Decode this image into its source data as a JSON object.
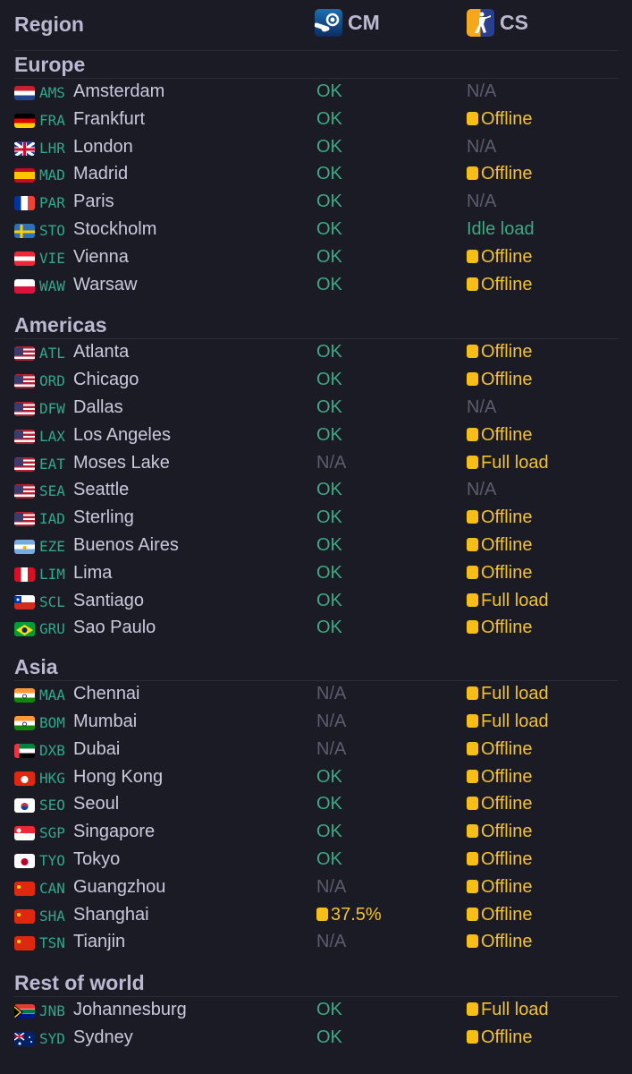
{
  "header": {
    "region_label": "Region",
    "cm_label": "CM",
    "cs_label": "CS",
    "cm_icon": "steam-icon",
    "cs_icon": "counter-strike-icon"
  },
  "colors": {
    "ok": "#3fa882",
    "na": "#5b5c6e",
    "warn": "#f2c230",
    "code": "#2fa98a",
    "bg": "#1b1b25"
  },
  "sections": [
    {
      "title": "Europe",
      "rows": [
        {
          "flag": "nl",
          "code": "AMS",
          "city": "Amsterdam",
          "cm": "OK",
          "cs": "N/A"
        },
        {
          "flag": "de",
          "code": "FRA",
          "city": "Frankfurt",
          "cm": "OK",
          "cs": "Offline"
        },
        {
          "flag": "gb",
          "code": "LHR",
          "city": "London",
          "cm": "OK",
          "cs": "N/A"
        },
        {
          "flag": "es",
          "code": "MAD",
          "city": "Madrid",
          "cm": "OK",
          "cs": "Offline"
        },
        {
          "flag": "fr",
          "code": "PAR",
          "city": "Paris",
          "cm": "OK",
          "cs": "N/A"
        },
        {
          "flag": "se",
          "code": "STO",
          "city": "Stockholm",
          "cm": "OK",
          "cs": "Idle load"
        },
        {
          "flag": "at",
          "code": "VIE",
          "city": "Vienna",
          "cm": "OK",
          "cs": "Offline"
        },
        {
          "flag": "pl",
          "code": "WAW",
          "city": "Warsaw",
          "cm": "OK",
          "cs": "Offline"
        }
      ]
    },
    {
      "title": "Americas",
      "rows": [
        {
          "flag": "us",
          "code": "ATL",
          "city": "Atlanta",
          "cm": "OK",
          "cs": "Offline"
        },
        {
          "flag": "us",
          "code": "ORD",
          "city": "Chicago",
          "cm": "OK",
          "cs": "Offline"
        },
        {
          "flag": "us",
          "code": "DFW",
          "city": "Dallas",
          "cm": "OK",
          "cs": "N/A"
        },
        {
          "flag": "us",
          "code": "LAX",
          "city": "Los Angeles",
          "cm": "OK",
          "cs": "Offline"
        },
        {
          "flag": "us",
          "code": "EAT",
          "city": "Moses Lake",
          "cm": "N/A",
          "cs": "Full load"
        },
        {
          "flag": "us",
          "code": "SEA",
          "city": "Seattle",
          "cm": "OK",
          "cs": "N/A"
        },
        {
          "flag": "us",
          "code": "IAD",
          "city": "Sterling",
          "cm": "OK",
          "cs": "Offline"
        },
        {
          "flag": "ar",
          "code": "EZE",
          "city": "Buenos Aires",
          "cm": "OK",
          "cs": "Offline"
        },
        {
          "flag": "pe",
          "code": "LIM",
          "city": "Lima",
          "cm": "OK",
          "cs": "Offline"
        },
        {
          "flag": "cl",
          "code": "SCL",
          "city": "Santiago",
          "cm": "OK",
          "cs": "Full load"
        },
        {
          "flag": "br",
          "code": "GRU",
          "city": "Sao Paulo",
          "cm": "OK",
          "cs": "Offline"
        }
      ]
    },
    {
      "title": "Asia",
      "rows": [
        {
          "flag": "in",
          "code": "MAA",
          "city": "Chennai",
          "cm": "N/A",
          "cs": "Full load"
        },
        {
          "flag": "in",
          "code": "BOM",
          "city": "Mumbai",
          "cm": "N/A",
          "cs": "Full load"
        },
        {
          "flag": "ae",
          "code": "DXB",
          "city": "Dubai",
          "cm": "N/A",
          "cs": "Offline"
        },
        {
          "flag": "hk",
          "code": "HKG",
          "city": "Hong Kong",
          "cm": "OK",
          "cs": "Offline"
        },
        {
          "flag": "kr",
          "code": "SEO",
          "city": "Seoul",
          "cm": "OK",
          "cs": "Offline"
        },
        {
          "flag": "sg",
          "code": "SGP",
          "city": "Singapore",
          "cm": "OK",
          "cs": "Offline"
        },
        {
          "flag": "jp",
          "code": "TYO",
          "city": "Tokyo",
          "cm": "OK",
          "cs": "Offline"
        },
        {
          "flag": "cn",
          "code": "CAN",
          "city": "Guangzhou",
          "cm": "N/A",
          "cs": "Offline"
        },
        {
          "flag": "cn",
          "code": "SHA",
          "city": "Shanghai",
          "cm": "37.5%",
          "cs": "Offline"
        },
        {
          "flag": "cn",
          "code": "TSN",
          "city": "Tianjin",
          "cm": "N/A",
          "cs": "Offline"
        }
      ]
    },
    {
      "title": "Rest of world",
      "rows": [
        {
          "flag": "za",
          "code": "JNB",
          "city": "Johannesburg",
          "cm": "OK",
          "cs": "Full load"
        },
        {
          "flag": "au",
          "code": "SYD",
          "city": "Sydney",
          "cm": "OK",
          "cs": "Offline"
        }
      ]
    }
  ]
}
